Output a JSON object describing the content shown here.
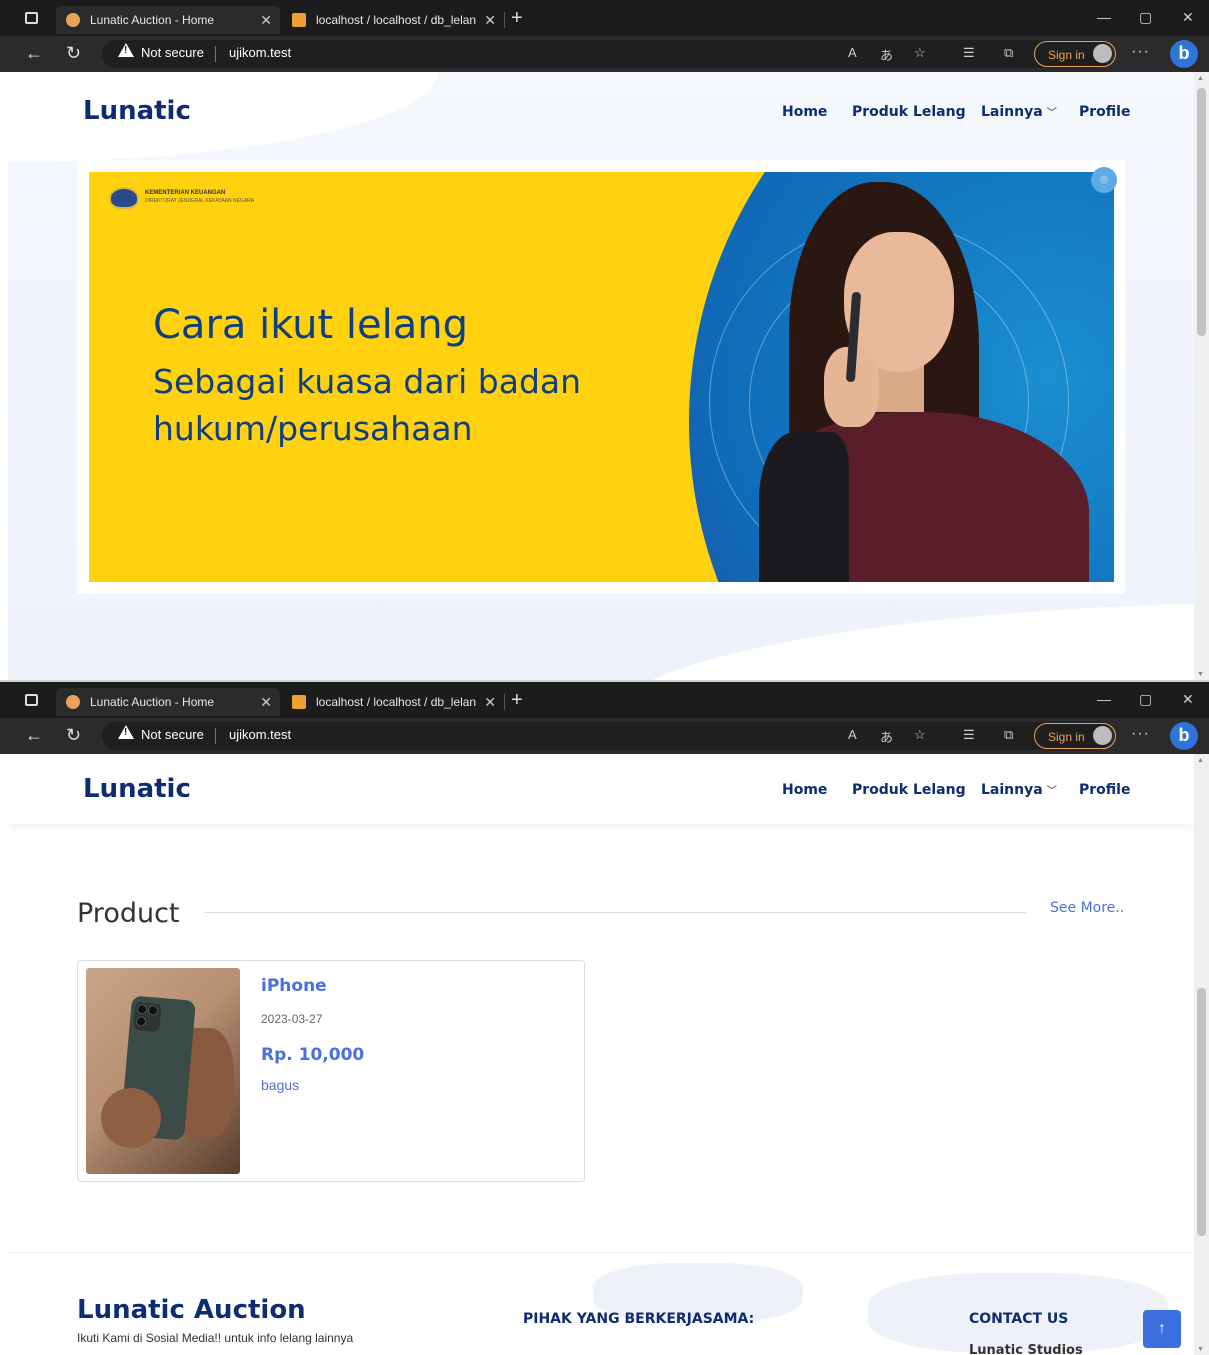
{
  "browser": {
    "tabs": [
      {
        "title": "Lunatic Auction - Home",
        "active": true
      },
      {
        "title": "localhost / localhost / db_lelang",
        "active": false
      }
    ],
    "security_label": "Not secure",
    "url": "ujikom.test",
    "signin_label": "Sign in",
    "more_label": "···",
    "bing_label": "b"
  },
  "navbar": {
    "brand": "Lunatic",
    "links": [
      "Home",
      "Produk Lelang",
      "Lainnya",
      "Profile"
    ]
  },
  "hero": {
    "logo_line1": "KEMENTERIAN KEUANGAN",
    "logo_line2": "DIREKTORAT JENDERAL KEKAYAAN NEGARA",
    "headline": "Cara ikut lelang",
    "subheadline": "Sebagai kuasa dari badan hukum/perusahaan"
  },
  "products": {
    "section_title": "Product",
    "see_more": "See More..",
    "items": [
      {
        "name": "iPhone",
        "date": "2023-03-27",
        "price": "Rp. 10,000",
        "description": "bagus"
      }
    ]
  },
  "footer": {
    "brand": "Lunatic Auction",
    "tagline": "Ikuti Kami di Sosial Media!! untuk info lelang lainnya",
    "partners_heading": "PIHAK YANG BERKERJASAMA:",
    "contact_heading": "CONTACT US",
    "company": "Lunatic Studios",
    "back_to_top": "↑"
  },
  "colors": {
    "brand_navy": "#0d2c72",
    "accent_blue": "#4a6fe0",
    "banner_yellow": "#ffd10f",
    "signin_orange": "#e8a25a"
  }
}
